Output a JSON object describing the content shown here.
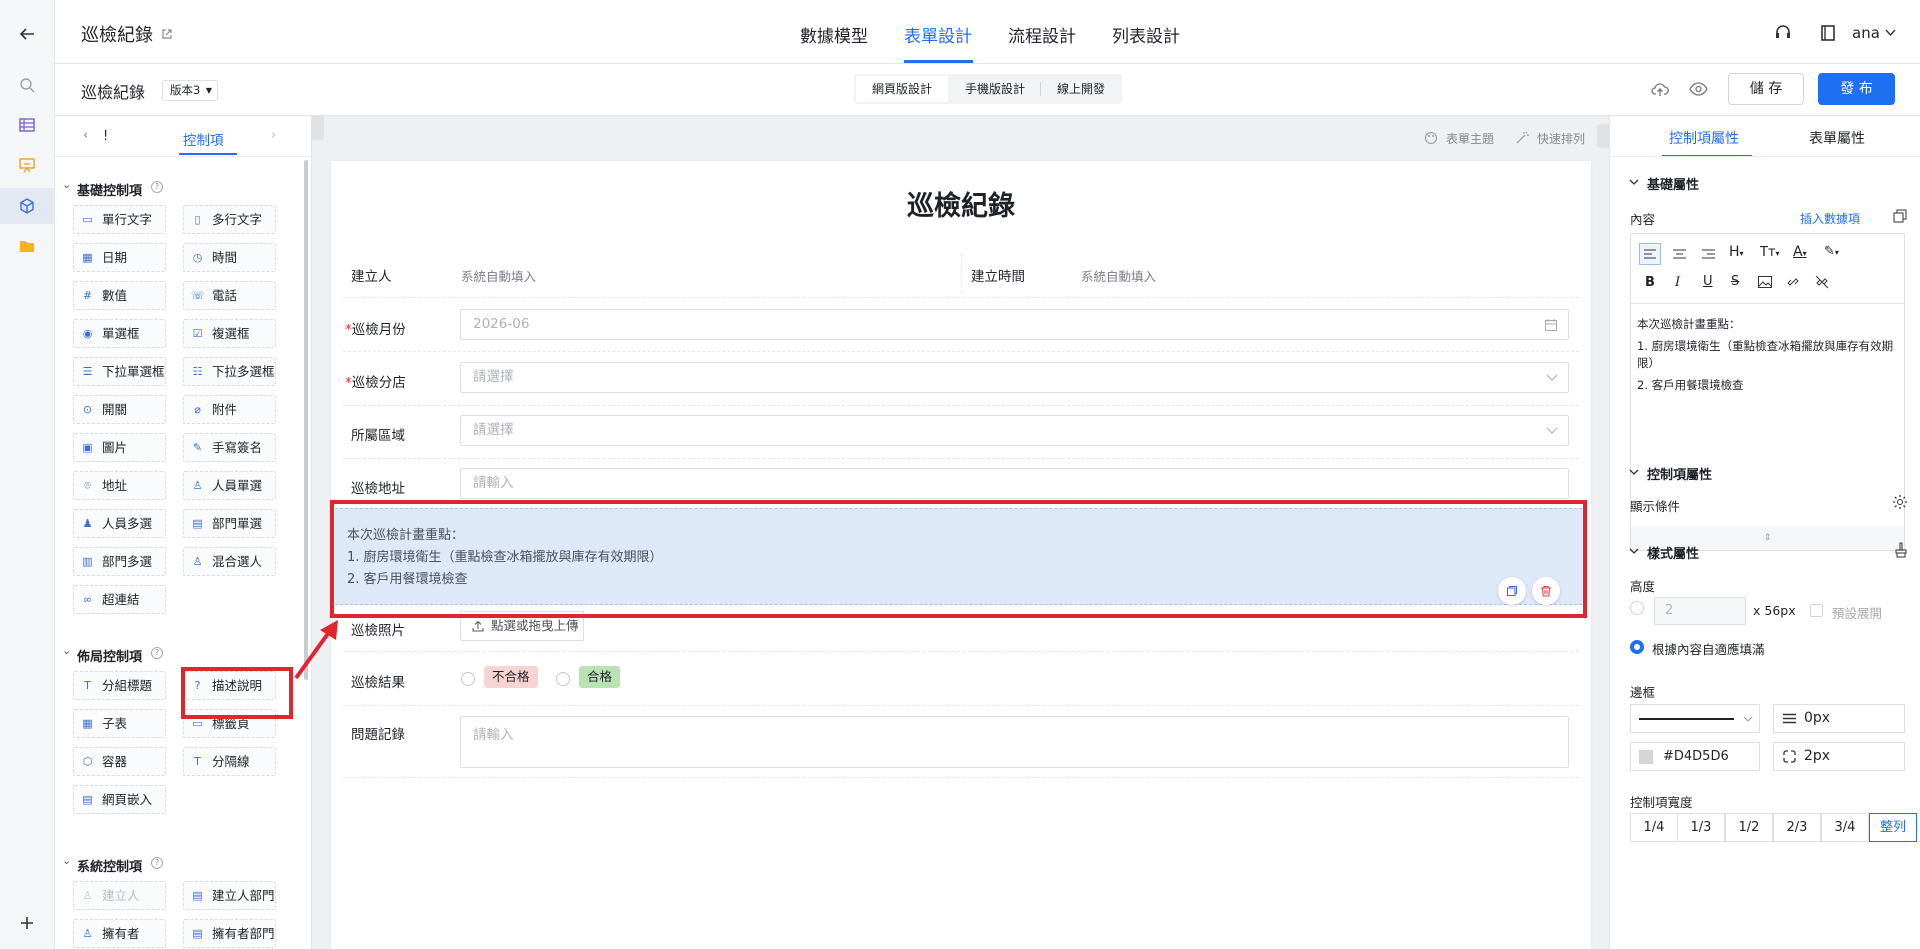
{
  "header": {
    "title": "巡檢紀錄",
    "tabs": [
      "數據模型",
      "表單設計",
      "流程設計",
      "列表設計"
    ],
    "active_tab": "表單設計",
    "user": "ana"
  },
  "subheader": {
    "form_name": "巡檢紀錄",
    "version": "版本3",
    "modes": [
      "網頁版設計",
      "手機版設計",
      "線上開發"
    ],
    "save": "儲 存",
    "publish": "發 布"
  },
  "left_panel": {
    "tab_prev": "!",
    "tab": "控制項",
    "sections": [
      {
        "title": "基礎控制項",
        "items": [
          {
            "label": "單行文字",
            "icon": "text-input-icon"
          },
          {
            "label": "多行文字",
            "icon": "textarea-icon"
          },
          {
            "label": "日期",
            "icon": "calendar-icon"
          },
          {
            "label": "時間",
            "icon": "clock-icon"
          },
          {
            "label": "數值",
            "icon": "number-icon"
          },
          {
            "label": "電話",
            "icon": "phone-icon"
          },
          {
            "label": "單選框",
            "icon": "radio-icon"
          },
          {
            "label": "複選框",
            "icon": "checkbox-icon"
          },
          {
            "label": "下拉單選框",
            "icon": "dropdown-single-icon"
          },
          {
            "label": "下拉多選框",
            "icon": "dropdown-multi-icon"
          },
          {
            "label": "開關",
            "icon": "switch-icon"
          },
          {
            "label": "附件",
            "icon": "paperclip-icon"
          },
          {
            "label": "圖片",
            "icon": "image-icon"
          },
          {
            "label": "手寫簽名",
            "icon": "pen-icon"
          },
          {
            "label": "地址",
            "icon": "location-icon"
          },
          {
            "label": "人員單選",
            "icon": "user-icon"
          },
          {
            "label": "人員多選",
            "icon": "users-icon"
          },
          {
            "label": "部門單選",
            "icon": "department-icon"
          },
          {
            "label": "部門多選",
            "icon": "departments-icon"
          },
          {
            "label": "混合選人",
            "icon": "user-mixed-icon"
          },
          {
            "label": "超連結",
            "icon": "link-icon"
          }
        ]
      },
      {
        "title": "佈局控制項",
        "items": [
          {
            "label": "分組標題",
            "icon": "title-icon"
          },
          {
            "label": "描述說明",
            "icon": "question-circle-icon"
          },
          {
            "label": "子表",
            "icon": "table-icon"
          },
          {
            "label": "標籤頁",
            "icon": "tabs-icon"
          },
          {
            "label": "容器",
            "icon": "container-icon"
          },
          {
            "label": "分隔線",
            "icon": "divider-icon"
          },
          {
            "label": "網頁嵌入",
            "icon": "embed-icon"
          }
        ]
      },
      {
        "title": "系統控制項",
        "items": [
          {
            "label": "建立人",
            "icon": "user-icon",
            "disabled": true
          },
          {
            "label": "建立人部門",
            "icon": "department-icon"
          },
          {
            "label": "擁有者",
            "icon": "user-icon"
          },
          {
            "label": "擁有者部門",
            "icon": "department-icon"
          }
        ]
      }
    ]
  },
  "canvas": {
    "toolbar": {
      "theme": "表單主題",
      "arrange": "快速排列"
    },
    "form_title": "巡檢紀錄",
    "creator_label": "建立人",
    "creator_value": "系統自動填入",
    "created_label": "建立時間",
    "created_value": "系統自動填入",
    "month_label": "巡檢月份",
    "month_value": "2026-06",
    "store_label": "巡檢分店",
    "store_placeholder": "請選擇",
    "area_label": "所屬區域",
    "area_placeholder": "請選擇",
    "address_label": "巡檢地址",
    "address_placeholder": "請輸入",
    "desc_lines": [
      "本次巡檢計畫重點：",
      "1. 廚房環境衛生（重點檢查冰箱擺放與庫存有效期限）",
      "2. 客戶用餐環境檢查"
    ],
    "photo_label": "巡檢照片",
    "upload_label": "點選或拖曳上傳",
    "result_label": "巡檢結果",
    "result_fail": "不合格",
    "result_pass": "合格",
    "issue_label": "問題記錄",
    "issue_placeholder": "請輸入"
  },
  "right_panel": {
    "tabs": [
      "控制項屬性",
      "表單屬性"
    ],
    "basic": "基礎屬性",
    "content": "內容",
    "insert_data": "插入數據項",
    "editor_lines": [
      "本次巡檢計畫重點：",
      "1. 廚房環境衛生（重點檢查冰箱擺放與庫存有效期限）",
      "2. 客戶用餐環境檢查"
    ],
    "ctl_props": "控制項屬性",
    "display_cond": "顯示條件",
    "style_props": "樣式屬性",
    "height": "高度",
    "height_value": "2",
    "height_unit": "x 56px",
    "default_expand": "預設展開",
    "auto_fit": "根據內容自適應填滿",
    "border": "邊框",
    "border_width": "0px",
    "border_color": "#D4D5D6",
    "border_radius": "2px",
    "width_label": "控制項寬度",
    "widths": [
      "1/4",
      "1/3",
      "1/2",
      "2/3",
      "3/4",
      "整列"
    ],
    "width_selected": "整列"
  },
  "colors": {
    "accent": "#1f6ff2",
    "highlight": "#e33",
    "selection_bg": "#dde9f9"
  }
}
